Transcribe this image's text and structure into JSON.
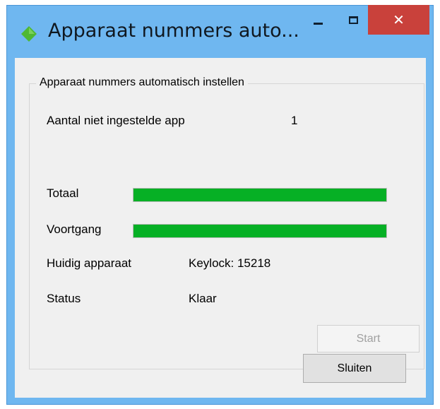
{
  "window": {
    "title": "Apparaat nummers auto...",
    "icon": "green-diamond-icon",
    "close_glyph": "✕"
  },
  "groupbox": {
    "legend": "Apparaat nummers automatisch instellen"
  },
  "fields": {
    "unset_label": "Aantal niet ingestelde app",
    "unset_value": "1",
    "total_label": "Totaal",
    "progress_label": "Voortgang",
    "current_label": "Huidig apparaat",
    "current_value": "Keylock: 15218",
    "status_label": "Status",
    "status_value": "Klaar"
  },
  "progress": {
    "total_fraction": 1.0,
    "progress_fraction": 1.0
  },
  "buttons": {
    "start": "Start",
    "close": "Sluiten"
  },
  "colors": {
    "title_bar": "#6fb7f0",
    "close_button": "#c9413b",
    "progress_fill": "#06b025",
    "app_icon": "#4fb833"
  }
}
